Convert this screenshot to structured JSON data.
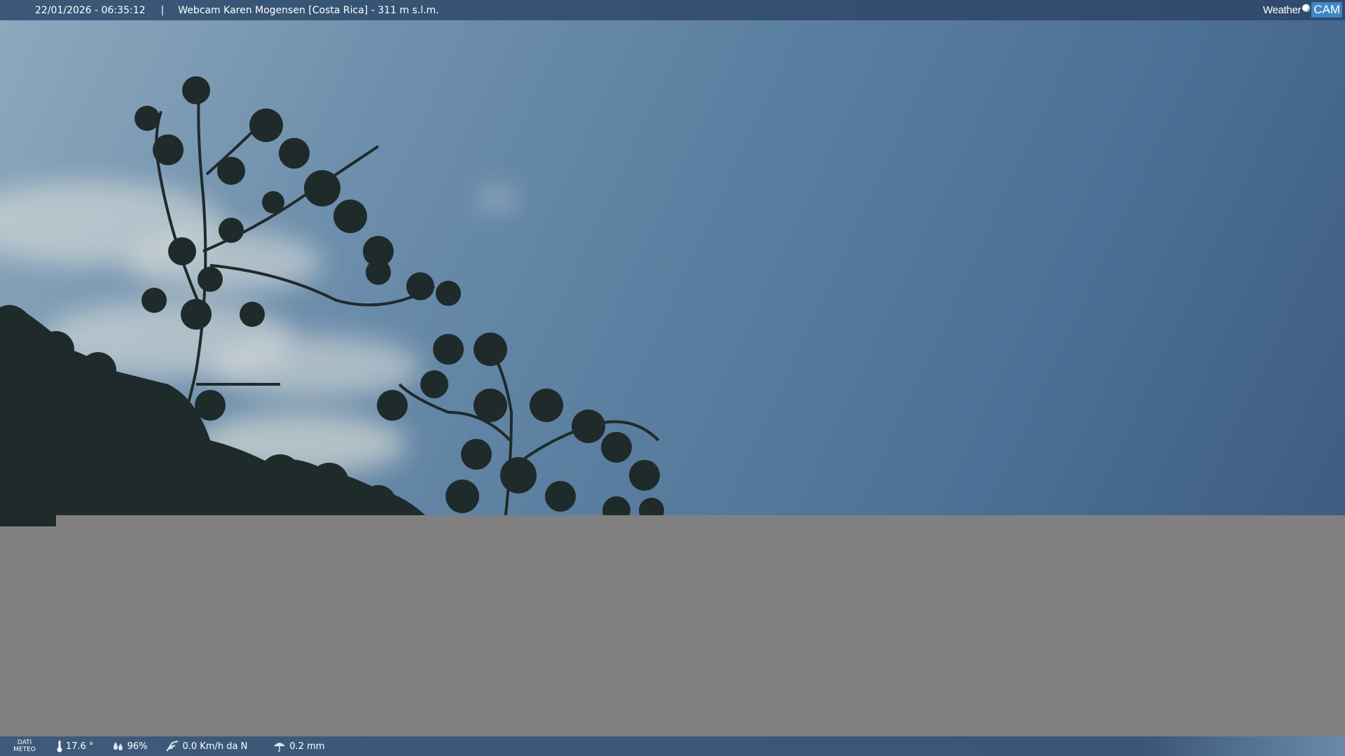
{
  "header": {
    "datetime": "22/01/2026 - 06:35:12",
    "separator": "|",
    "title": "Webcam Karen Mogensen [Costa Rica]  - 311 m s.l.m.",
    "logo_weather": "Weather",
    "logo_cam": "CAM"
  },
  "footer": {
    "dati_line1": "DATI",
    "dati_line2": "METEO",
    "temperature": "17.6 °",
    "humidity": "96%",
    "wind": "0.0 Km/h da N",
    "rain": "0.2 mm"
  },
  "icons": {
    "temperature": "thermometer-icon",
    "humidity": "humidity-drops-icon",
    "wind": "wind-icon",
    "rain": "rain-umbrella-icon"
  },
  "colors": {
    "bar": "#3b5878",
    "sky_light": "#8da8bd",
    "sky_dark": "#3d5c80",
    "mask_gray": "#808080",
    "logo_accent": "#3e86c6"
  }
}
